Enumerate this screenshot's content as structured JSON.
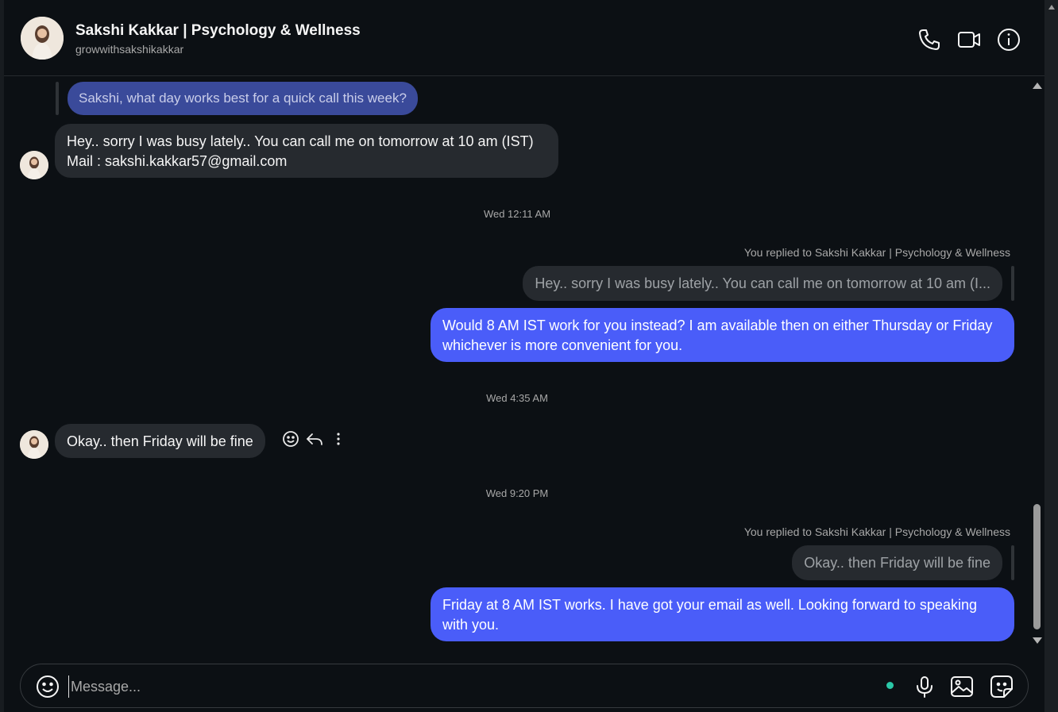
{
  "header": {
    "title": "Sakshi Kakkar | Psychology & Wellness",
    "username": "growwithsakshikakkar",
    "icons": [
      "phone-icon",
      "video-icon",
      "info-icon"
    ]
  },
  "messages": {
    "quoted_question": "Sakshi, what day works best for a quick call this week?",
    "msg1_line1": "Hey.. sorry I was busy lately..  You can call me on tomorrow at 10 am (IST)",
    "msg1_line2": "Mail : sakshi.kakkar57@gmail.com",
    "ts1": "Wed 12:11 AM",
    "reply_note_1": "You replied to Sakshi Kakkar | Psychology & Wellness",
    "quoted_reply_1": "Hey.. sorry I was busy lately.. You can call me on tomorrow at 10 am (I...",
    "msg2": "Would 8 AM IST work for you instead? I am available then on either Thursday or Friday whichever is more convenient for you.",
    "ts2": "Wed 4:35 AM",
    "msg3": "Okay.. then Friday will be fine",
    "ts3": "Wed 9:20 PM",
    "reply_note_2": "You replied to Sakshi Kakkar | Psychology & Wellness",
    "quoted_reply_2": "Okay.. then Friday will be fine",
    "msg4": "Friday at 8 AM IST works. I have got your email as well. Looking forward to speaking with you."
  },
  "composer": {
    "placeholder": "Message...",
    "icons": [
      "emoji-icon",
      "microphone-icon",
      "image-icon",
      "sticker-icon"
    ]
  },
  "colors": {
    "background": "#0c1014",
    "outgoing_bubble": "#4a5df9",
    "incoming_bubble": "#262a2f",
    "online_dot": "#2ac7a7"
  }
}
